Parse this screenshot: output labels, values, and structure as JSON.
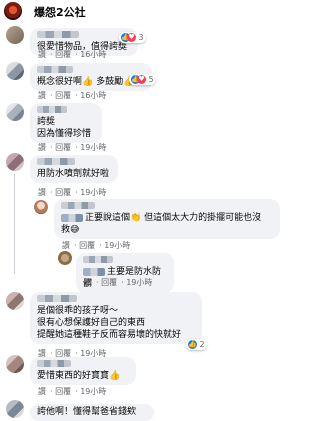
{
  "header": {
    "page_name": "爆怨2公社"
  },
  "actions": {
    "like": "讚",
    "reply": "回覆"
  },
  "comments": [
    {
      "text": [
        "很愛惜物品，值得誇獎"
      ],
      "time": "16小時",
      "reactions": "3",
      "reaction_types": [
        "like",
        "love"
      ]
    },
    {
      "text": [
        "概念很好啊👍 多鼓勵👍"
      ],
      "time": "16小時",
      "reactions": "5",
      "reaction_types": [
        "like",
        "love"
      ]
    },
    {
      "text": [
        "誇獎",
        "因為懂得珍惜"
      ],
      "time": "19小時",
      "reactions": "",
      "reaction_types": []
    },
    {
      "text": [
        "用防水噴劑就好啦"
      ],
      "time": "19小時",
      "reactions": "",
      "reaction_types": []
    },
    {
      "text": [
        "正要說這個👏 但這個太大力的掛擺可能也沒",
        "救😅"
      ],
      "time": "19小時",
      "reactions": "",
      "reaction_types": []
    },
    {
      "text": [
        "主要是防水防髒"
      ],
      "time": "19小時",
      "reactions": "",
      "reaction_types": []
    },
    {
      "text": [
        "是個很乖的孩子呀～",
        "很有心想保護好自己的東西",
        "提醒她這種鞋子反而容易壞的快就好"
      ],
      "time": "19小時",
      "reactions": "2",
      "reaction_types": [
        "like"
      ]
    },
    {
      "text": [
        "愛惜東西的好寶寶👍"
      ],
      "time": "19小時",
      "reactions": "",
      "reaction_types": []
    },
    {
      "text": [
        "誇他啊！懂得幫爸省錢欸"
      ],
      "time": "",
      "reactions": "",
      "reaction_types": []
    }
  ],
  "colors": {
    "bubble_bg": "#f0f2f5",
    "meta_text": "#65676b",
    "like_blue": "#1877f2",
    "love_red": "#f33e58"
  }
}
